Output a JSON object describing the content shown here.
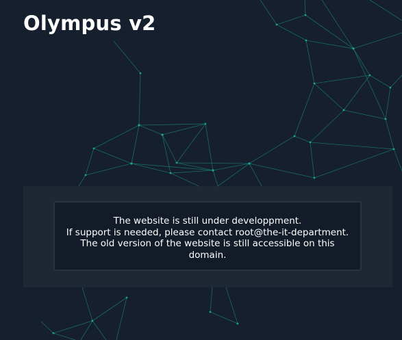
{
  "header": {
    "title": "Olympus v2"
  },
  "notice": {
    "lines": [
      "The website is still under developpment.",
      "If support is needed, please contact root@the-it-department.",
      "The old version of the website is still accessible on this domain."
    ]
  },
  "colors": {
    "background": "#161f2d",
    "panel": "#202936",
    "message_box": "#131a28",
    "network_lines": "#1aa89a",
    "text": "#ffffff"
  }
}
